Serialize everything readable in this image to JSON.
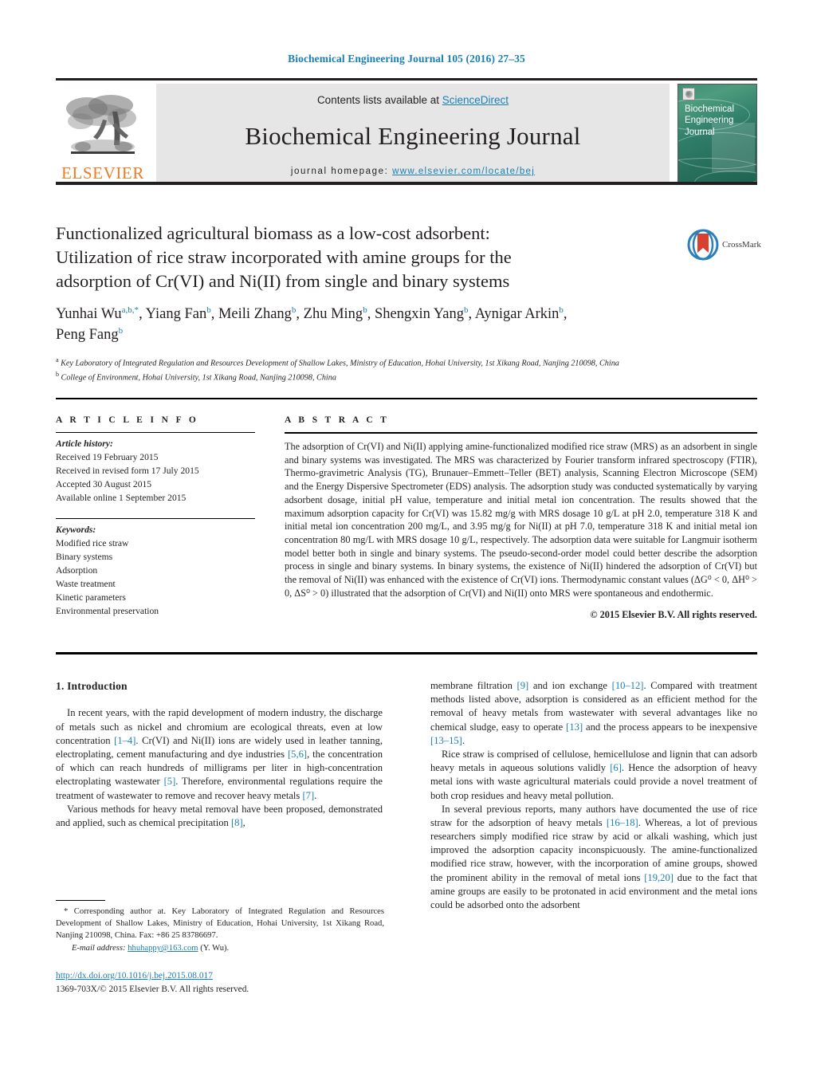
{
  "running_head": "Biochemical Engineering Journal 105 (2016) 27–35",
  "masthead": {
    "contents_prefix": "Contents lists available at ",
    "sciencedirect": "ScienceDirect",
    "journal_title": "Biochemical Engineering Journal",
    "homepage_label": "journal homepage:",
    "homepage_url": "www.elsevier.com/locate/bej",
    "publisher": "ELSEVIER",
    "cover_title_line1": "Biochemical",
    "cover_title_line2": "Engineering",
    "cover_title_line3": "Journal",
    "accent_color": "#1a7fb5",
    "elsevier_orange": "#ec7d25"
  },
  "article": {
    "title_line1": "Functionalized agricultural biomass as a low-cost adsorbent:",
    "title_line2": "Utilization of rice straw incorporated with amine groups for the",
    "title_line3": "adsorption of Cr(VI) and Ni(II) from single and binary systems",
    "crossmark_label": "CrossMark",
    "authors_line1_part1": "Yunhai Wu",
    "authors_line1_sup1": "a,b,*",
    "authors_line1_part2": ", Yiang Fan",
    "authors_line1_sup2": "b",
    "authors_line1_part3": ", Meili Zhang",
    "authors_line1_sup3": "b",
    "authors_line1_part4": ", Zhu Ming",
    "authors_line1_sup4": "b",
    "authors_line1_part5": ", Shengxin Yang",
    "authors_line1_sup5": "b",
    "authors_line1_part6": ", Aynigar Arkin",
    "authors_line1_sup6": "b",
    "authors_line1_part7": ",",
    "authors_line2_part1": "Peng Fang",
    "authors_line2_sup1": "b",
    "affil_a_sup": "a",
    "affil_a": "Key Laboratory of Integrated Regulation and Resources Development of Shallow Lakes, Ministry of Education, Hohai University, 1st Xikang Road, Nanjing 210098, China",
    "affil_b_sup": "b",
    "affil_b": "College of Environment, Hohai University, 1st Xikang Road, Nanjing 210098, China"
  },
  "article_info": {
    "heading": "A R T I C L E   I N F O",
    "history_label": "Article history:",
    "history": [
      "Received 19 February 2015",
      "Received in revised form 17 July 2015",
      "Accepted 30 August 2015",
      "Available online 1 September 2015"
    ],
    "keywords_label": "Keywords:",
    "keywords": [
      "Modified rice straw",
      "Binary systems",
      "Adsorption",
      "Waste treatment",
      "Kinetic parameters",
      "Environmental preservation"
    ]
  },
  "abstract": {
    "heading": "A B S T R A C T",
    "text": "The adsorption of Cr(VI) and Ni(II) applying amine-functionalized modified rice straw (MRS) as an adsorbent in single and binary systems was investigated. The MRS was characterized by Fourier transform infrared spectroscopy (FTIR), Thermo-gravimetric Analysis (TG), Brunauer–Emmett–Teller (BET) analysis, Scanning Electron Microscope (SEM) and the Energy Dispersive Spectrometer (EDS) analysis. The adsorption study was conducted systematically by varying adsorbent dosage, initial pH value, temperature and initial metal ion concentration. The results showed that the maximum adsorption capacity for Cr(VI) was 15.82 mg/g with MRS dosage 10 g/L at pH 2.0, temperature 318 K and initial metal ion concentration 200 mg/L, and 3.95 mg/g for Ni(II) at pH 7.0, temperature 318 K and initial metal ion concentration 80 mg/L with MRS dosage 10 g/L, respectively. The adsorption data were suitable for Langmuir isotherm model better both in single and binary systems. The pseudo-second-order model could better describe the adsorption process in single and binary systems. In binary systems, the existence of Ni(II) hindered the adsorption of Cr(VI) but the removal of Ni(II) was enhanced with the existence of Cr(VI) ions. Thermodynamic constant values (ΔG⁰ < 0, ΔH⁰ > 0, ΔS⁰ > 0) illustrated that the adsorption of Cr(VI) and Ni(II) onto MRS were spontaneous and endothermic.",
    "copyright": "© 2015 Elsevier B.V. All rights reserved."
  },
  "introduction": {
    "heading": "1.  Introduction",
    "left_p1_a": "In recent years, with the rapid development of modern industry, the discharge of metals such as nickel and chromium are ecological threats, even at low concentration ",
    "left_p1_r1": "[1–4]",
    "left_p1_b": ". Cr(VI) and Ni(II) ions are widely used in leather tanning, electroplating, cement manufacturing and dye industries ",
    "left_p1_r2": "[5,6]",
    "left_p1_c": ", the concentration of which can reach hundreds of milligrams per liter in high-concentration electroplating wastewater ",
    "left_p1_r3": "[5]",
    "left_p1_d": ". Therefore, environmental regulations require the treatment of wastewater to remove and recover heavy metals ",
    "left_p1_r4": "[7]",
    "left_p1_e": ".",
    "left_p2_a": "Various methods for heavy metal removal have been proposed, demonstrated and applied, such as chemical precipitation ",
    "left_p2_r1": "[8]",
    "left_p2_b": ",",
    "right_p1_a": "membrane filtration ",
    "right_p1_r1": "[9]",
    "right_p1_b": " and ion exchange ",
    "right_p1_r2": "[10–12]",
    "right_p1_c": ". Compared with treatment methods listed above, adsorption is considered as an efficient method for the removal of heavy metals from wastewater with several advantages like no chemical sludge, easy to operate ",
    "right_p1_r3": "[13]",
    "right_p1_d": " and the process appears to be inexpensive ",
    "right_p1_r4": "[13–15]",
    "right_p1_e": ".",
    "right_p2_a": "Rice straw is comprised of cellulose, hemicellulose and lignin that can adsorb heavy metals in aqueous solutions validly ",
    "right_p2_r1": "[6]",
    "right_p2_b": ". Hence the adsorption of heavy metal ions with waste agricultural materials could provide a novel treatment of both crop residues and heavy metal pollution.",
    "right_p3_a": "In several previous reports, many authors have documented the use of rice straw for the adsorption of heavy metals ",
    "right_p3_r1": "[16–18]",
    "right_p3_b": ". Whereas, a lot of previous researchers simply modified rice straw by acid or alkali washing, which just improved the adsorption capacity inconspicuously. The amine-functionalized modified rice straw, however, with the incorporation of amine groups, showed the prominent ability in the removal of metal ions ",
    "right_p3_r2": "[19,20]",
    "right_p3_c": " due to the fact that amine groups are easily to be protonated in acid environment and the metal ions could be adsorbed onto the adsorbent"
  },
  "footnotes": {
    "corresponding": "* Corresponding author at. Key Laboratory of Integrated Regulation and Resources Development of Shallow Lakes, Ministry of Education, Hohai University, 1st Xikang Road, Nanjing 210098, China. Fax: +86 25 83786697.",
    "email_label": "E-mail address:",
    "email": "hhuhappy@163.com",
    "email_suffix": " (Y. Wu)."
  },
  "bottom": {
    "doi": "http://dx.doi.org/10.1016/j.bej.2015.08.017",
    "issn_copyright": "1369-703X/© 2015 Elsevier B.V. All rights reserved."
  }
}
